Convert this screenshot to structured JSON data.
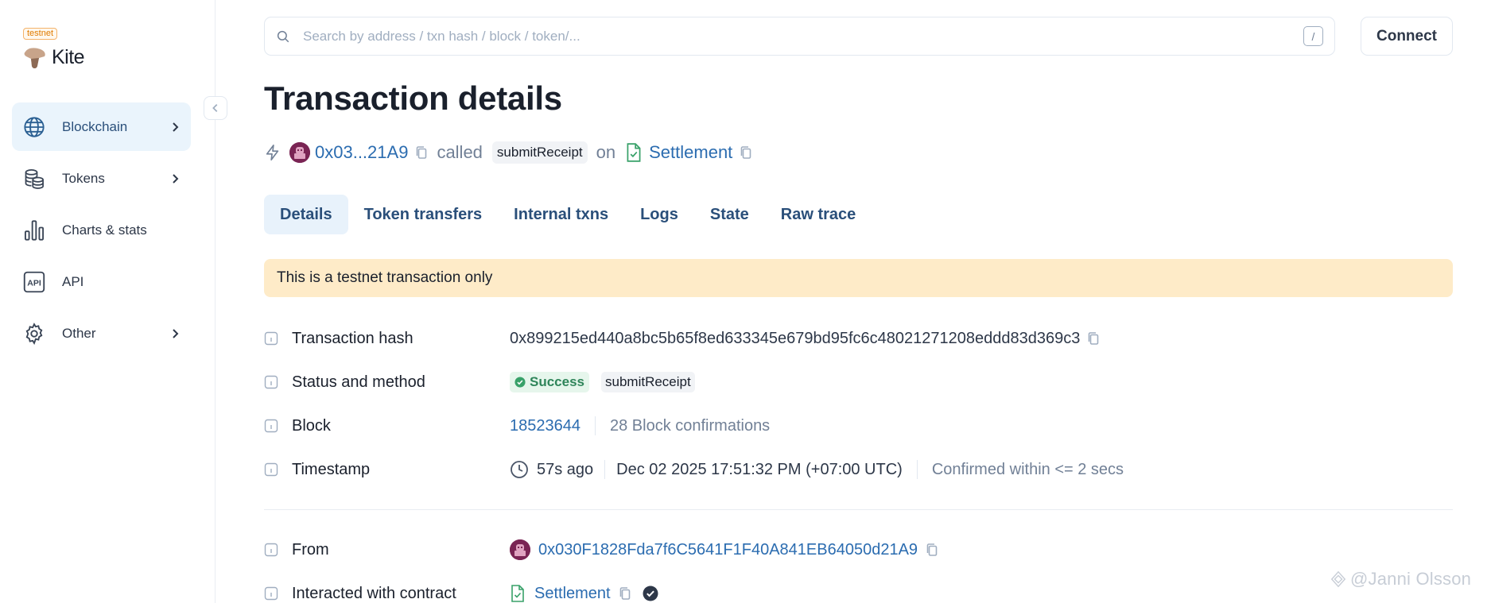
{
  "brand": {
    "badge": "testnet",
    "name": "Kite"
  },
  "sidebar": {
    "items": [
      {
        "label": "Blockchain",
        "icon": "globe-icon",
        "active": true,
        "has_submenu": true
      },
      {
        "label": "Tokens",
        "icon": "coins-icon",
        "active": false,
        "has_submenu": true
      },
      {
        "label": "Charts & stats",
        "icon": "bar-chart-icon",
        "active": false,
        "has_submenu": false
      },
      {
        "label": "API",
        "icon": "api-icon",
        "active": false,
        "has_submenu": false
      },
      {
        "label": "Other",
        "icon": "gear-icon",
        "active": false,
        "has_submenu": true
      }
    ]
  },
  "search": {
    "placeholder": "Search by address / txn hash / block / token/...",
    "shortcut": "/"
  },
  "header": {
    "connect_label": "Connect",
    "title": "Transaction details"
  },
  "summary": {
    "from_short": "0x03...21A9",
    "verb": "called",
    "method": "submitReceipt",
    "preposition": "on",
    "contract": "Settlement"
  },
  "tabs": [
    {
      "label": "Details",
      "active": true
    },
    {
      "label": "Token transfers",
      "active": false
    },
    {
      "label": "Internal txns",
      "active": false
    },
    {
      "label": "Logs",
      "active": false
    },
    {
      "label": "State",
      "active": false
    },
    {
      "label": "Raw trace",
      "active": false
    }
  ],
  "alert": {
    "text": "This is a testnet transaction only"
  },
  "details": {
    "tx_hash": {
      "label": "Transaction hash",
      "value": "0x899215ed440a8bc5b65f8ed633345e679bd95fc6c48021271208eddd83d369c3"
    },
    "status": {
      "label": "Status and method",
      "status": "Success",
      "method": "submitReceipt"
    },
    "block": {
      "label": "Block",
      "number": "18523644",
      "confirmations": "28 Block confirmations"
    },
    "timestamp": {
      "label": "Timestamp",
      "age": "57s ago",
      "datetime": "Dec 02 2025 17:51:32 PM (+07:00 UTC)",
      "confirmed": "Confirmed within <= 2 secs"
    },
    "from": {
      "label": "From",
      "address": "0x030F1828Fda7f6C5641F1F40A841EB64050d21A9"
    },
    "contract": {
      "label": "Interacted with contract",
      "name": "Settlement"
    }
  },
  "watermark": {
    "text": "@Janni Olsson"
  },
  "colors": {
    "link": "#2b6cb0",
    "active_nav_bg": "#eaf4fc",
    "alert_bg": "#feebc8",
    "success": "#2f855a",
    "avatar": "#7a2454"
  }
}
